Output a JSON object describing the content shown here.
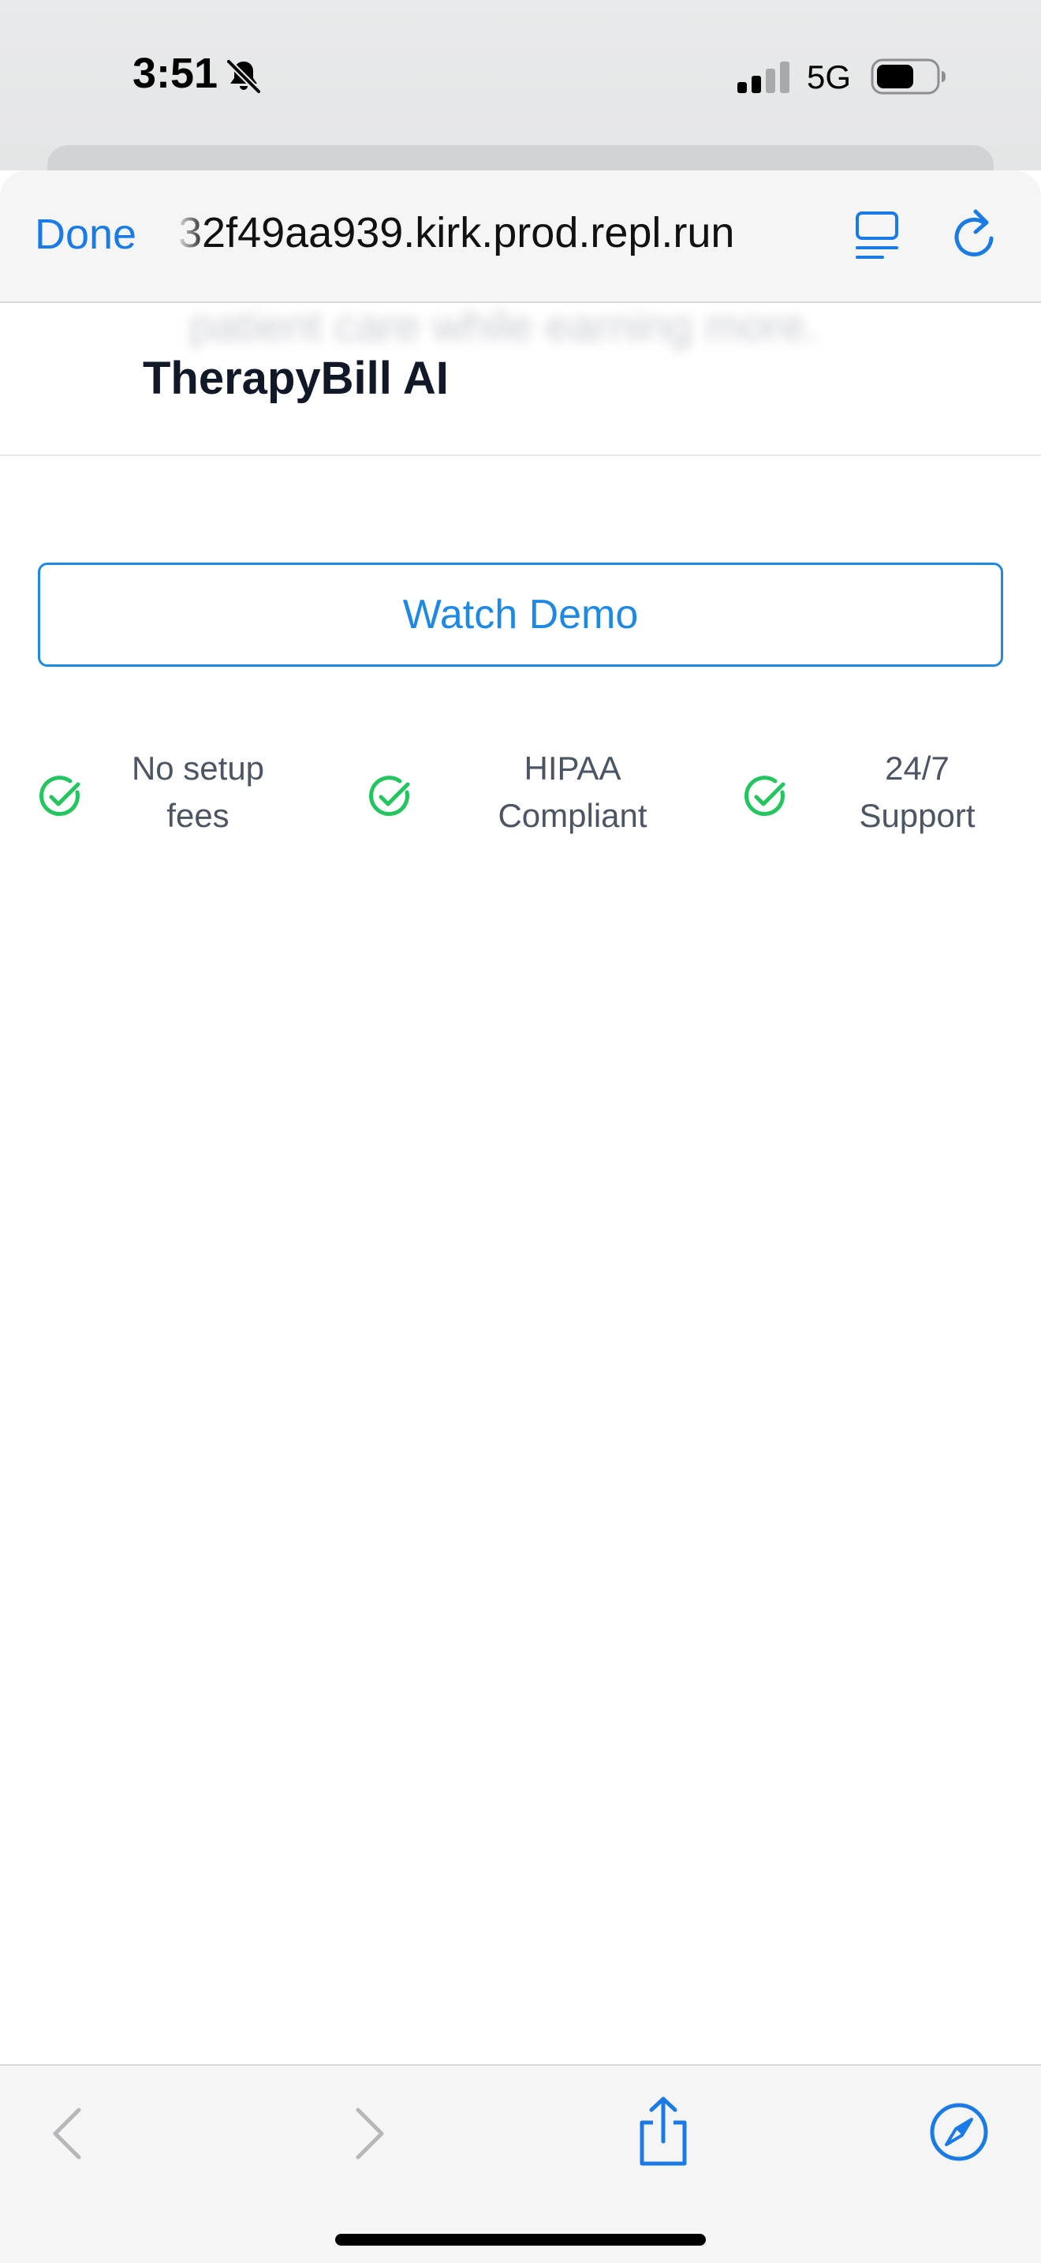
{
  "status_bar": {
    "time": "3:51",
    "network": "5G",
    "icons": [
      "bell-slash-icon",
      "cellular-signal-icon",
      "battery-icon"
    ]
  },
  "browser": {
    "done_label": "Done",
    "url": "32f49aa939.kirk.prod.repl.run",
    "icons": [
      "reader-mode-icon",
      "reload-icon"
    ],
    "accent_color": "#1a7be6"
  },
  "page": {
    "brand": "TherapyBill AI",
    "scrolled_text": "patient care while earning more.",
    "watch_demo_label": "Watch Demo",
    "features": [
      {
        "line1": "No setup",
        "line2": "fees"
      },
      {
        "line1": "HIPAA",
        "line2": "Compliant"
      },
      {
        "line1": "24/7",
        "line2": "Support"
      }
    ],
    "check_color": "#22c55e",
    "button_color": "#1e88e5"
  },
  "toolbar": {
    "icons": [
      "back-chevron-icon",
      "forward-chevron-icon",
      "share-icon",
      "compass-icon"
    ]
  }
}
